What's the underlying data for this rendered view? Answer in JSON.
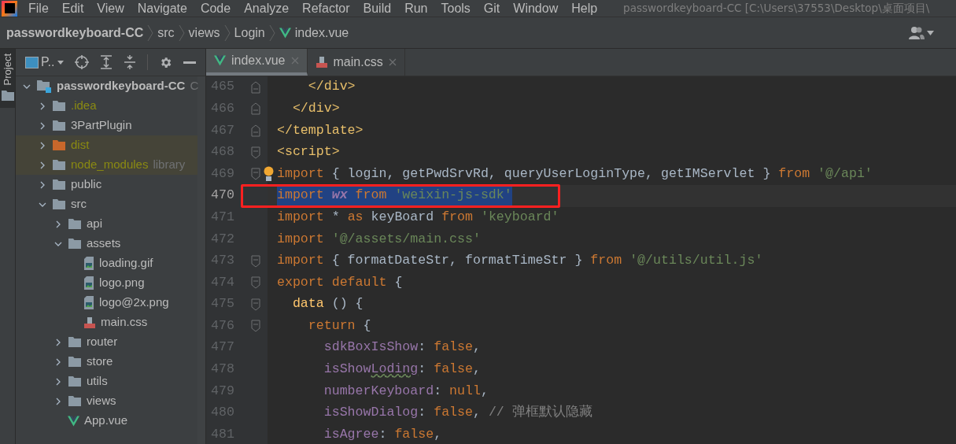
{
  "menu_bar": {
    "items": [
      "File",
      "Edit",
      "View",
      "Navigate",
      "Code",
      "Analyze",
      "Refactor",
      "Build",
      "Run",
      "Tools",
      "Git",
      "Window",
      "Help"
    ],
    "window_title": "passwordkeyboard-CC [C:\\Users\\37553\\Desktop\\桌面项目\\"
  },
  "breadcrumb": [
    {
      "label": "passwordkeyboard-CC",
      "kind": "project"
    },
    {
      "label": "src",
      "kind": "folder"
    },
    {
      "label": "views",
      "kind": "folder"
    },
    {
      "label": "Login",
      "kind": "folder"
    },
    {
      "label": "index.vue",
      "kind": "vue"
    }
  ],
  "tool_strip": {
    "label": "Project",
    "selected": true
  },
  "project_panel": {
    "title": "P..",
    "tree": [
      {
        "name": "passwordkeyboard-CC",
        "suffix": "C",
        "kind": "module",
        "expanded": true,
        "children": [
          {
            "name": ".idea",
            "kind": "folder",
            "expanded": false,
            "ignored": true,
            "excluded": false
          },
          {
            "name": "3PartPlugin",
            "kind": "folder",
            "expanded": false,
            "ignored": false,
            "excluded": false
          },
          {
            "name": "dist",
            "kind": "excluded-folder",
            "expanded": false,
            "ignored": true,
            "excluded": true
          },
          {
            "name": "node_modules",
            "suffix": "library",
            "kind": "folder",
            "expanded": false,
            "ignored": true,
            "excluded": true
          },
          {
            "name": "public",
            "kind": "folder",
            "expanded": false,
            "ignored": false,
            "excluded": false
          },
          {
            "name": "src",
            "kind": "folder",
            "expanded": true,
            "ignored": false,
            "excluded": false,
            "children": [
              {
                "name": "api",
                "kind": "folder",
                "expanded": false,
                "ignored": false,
                "excluded": false
              },
              {
                "name": "assets",
                "kind": "folder",
                "expanded": true,
                "ignored": false,
                "excluded": false,
                "children": [
                  {
                    "name": "loading.gif",
                    "kind": "image",
                    "ignored": false,
                    "excluded": false
                  },
                  {
                    "name": "logo.png",
                    "kind": "image",
                    "ignored": false,
                    "excluded": false
                  },
                  {
                    "name": "logo@2x.png",
                    "kind": "image",
                    "ignored": false,
                    "excluded": false
                  },
                  {
                    "name": "main.css",
                    "kind": "css",
                    "ignored": false,
                    "excluded": false
                  }
                ]
              },
              {
                "name": "router",
                "kind": "folder",
                "expanded": false,
                "ignored": false,
                "excluded": false
              },
              {
                "name": "store",
                "kind": "folder",
                "expanded": false,
                "ignored": false,
                "excluded": false
              },
              {
                "name": "utils",
                "kind": "folder",
                "expanded": false,
                "ignored": false,
                "excluded": false
              },
              {
                "name": "views",
                "kind": "folder",
                "expanded": false,
                "ignored": false,
                "excluded": false
              },
              {
                "name": "App.vue",
                "kind": "vue",
                "ignored": false,
                "excluded": false
              }
            ]
          }
        ]
      }
    ]
  },
  "tabs": [
    {
      "label": "index.vue",
      "kind": "vue",
      "selected": true
    },
    {
      "label": "main.css",
      "kind": "css",
      "selected": false
    }
  ],
  "editor": {
    "lines": [
      {
        "number": "465",
        "kind": "fold-end",
        "selected": false,
        "tokens": [
          {
            "kind": "tag",
            "text": "    </div>"
          }
        ]
      },
      {
        "number": "466",
        "kind": "fold-end",
        "selected": false,
        "tokens": [
          {
            "kind": "tag",
            "text": "  </div>"
          }
        ]
      },
      {
        "number": "467",
        "kind": "fold-end",
        "selected": false,
        "tokens": [
          {
            "kind": "tag",
            "text": "</template>"
          }
        ]
      },
      {
        "number": "468",
        "kind": "fold-start",
        "selected": false,
        "tokens": [
          {
            "kind": "tag",
            "text": "<script>"
          }
        ]
      },
      {
        "number": "469",
        "kind": "fold-start",
        "selected": false,
        "tokens": [
          {
            "kind": "keyword",
            "text": "import"
          },
          {
            "kind": "plain",
            "text": " { login, getPwdSrvRd, queryUserLoginType, getIMServlet }"
          },
          {
            "kind": "keyword",
            "text": " from"
          },
          {
            "kind": "string",
            "text": " '@/api'"
          }
        ]
      },
      {
        "number": "470",
        "kind": "plain",
        "selected": true,
        "tokens": [
          {
            "kind": "keyword",
            "text": "import"
          },
          {
            "kind": "variable",
            "text": " wx"
          },
          {
            "kind": "keyword",
            "text": " from"
          },
          {
            "kind": "string",
            "text": " 'weixin-js-sdk'"
          }
        ]
      },
      {
        "number": "471",
        "kind": "plain",
        "selected": false,
        "tokens": [
          {
            "kind": "keyword",
            "text": "import"
          },
          {
            "kind": "plain",
            "text": " *"
          },
          {
            "kind": "keyword",
            "text": " as"
          },
          {
            "kind": "plain",
            "text": " keyBoard"
          },
          {
            "kind": "keyword",
            "text": " from"
          },
          {
            "kind": "string",
            "text": " 'keyboard'"
          }
        ]
      },
      {
        "number": "472",
        "kind": "plain",
        "selected": false,
        "tokens": [
          {
            "kind": "keyword",
            "text": "import"
          },
          {
            "kind": "string",
            "text": " '@/assets/main.css'"
          }
        ]
      },
      {
        "number": "473",
        "kind": "fold-start",
        "selected": false,
        "tokens": [
          {
            "kind": "keyword",
            "text": "import"
          },
          {
            "kind": "plain",
            "text": " { formatDateStr, formatTimeStr }"
          },
          {
            "kind": "keyword",
            "text": " from"
          },
          {
            "kind": "string",
            "text": " '@/utils/util.js'"
          }
        ]
      },
      {
        "number": "474",
        "kind": "fold-start",
        "selected": false,
        "tokens": [
          {
            "kind": "keyword",
            "text": "export default"
          },
          {
            "kind": "plain",
            "text": " {"
          }
        ]
      },
      {
        "number": "475",
        "kind": "fold-start",
        "selected": false,
        "tokens": [
          {
            "kind": "function",
            "text": "  data"
          },
          {
            "kind": "plain",
            "text": " () {"
          }
        ]
      },
      {
        "number": "476",
        "kind": "fold-start",
        "selected": false,
        "tokens": [
          {
            "kind": "keyword",
            "text": "    return"
          },
          {
            "kind": "plain",
            "text": " {"
          }
        ]
      },
      {
        "number": "477",
        "kind": "plain",
        "selected": false,
        "tokens": [
          {
            "kind": "property",
            "text": "      sdkBoxIsShow"
          },
          {
            "kind": "plain",
            "text": ":"
          },
          {
            "kind": "keyword",
            "text": " false"
          },
          {
            "kind": "plain",
            "text": ","
          }
        ]
      },
      {
        "number": "478",
        "kind": "plain",
        "selected": false,
        "tokens": [
          {
            "kind": "property",
            "text": "      isShow"
          },
          {
            "kind": "typo",
            "text": "Loding"
          },
          {
            "kind": "plain",
            "text": ":"
          },
          {
            "kind": "keyword",
            "text": " false"
          },
          {
            "kind": "plain",
            "text": ","
          }
        ]
      },
      {
        "number": "479",
        "kind": "plain",
        "selected": false,
        "tokens": [
          {
            "kind": "property",
            "text": "      numberKeyboard"
          },
          {
            "kind": "plain",
            "text": ":"
          },
          {
            "kind": "keyword",
            "text": " null"
          },
          {
            "kind": "plain",
            "text": ","
          }
        ]
      },
      {
        "number": "480",
        "kind": "plain",
        "selected": false,
        "tokens": [
          {
            "kind": "property",
            "text": "      isShowDialog"
          },
          {
            "kind": "plain",
            "text": ":"
          },
          {
            "kind": "keyword",
            "text": " false"
          },
          {
            "kind": "plain",
            "text": ","
          },
          {
            "kind": "comment",
            "text": " // 弹框默认隐藏"
          }
        ]
      },
      {
        "number": "481",
        "kind": "plain",
        "selected": false,
        "tokens": [
          {
            "kind": "property",
            "text": "      isAgree"
          },
          {
            "kind": "plain",
            "text": ":"
          },
          {
            "kind": "keyword",
            "text": " false"
          },
          {
            "kind": "plain",
            "text": ","
          }
        ]
      }
    ]
  }
}
